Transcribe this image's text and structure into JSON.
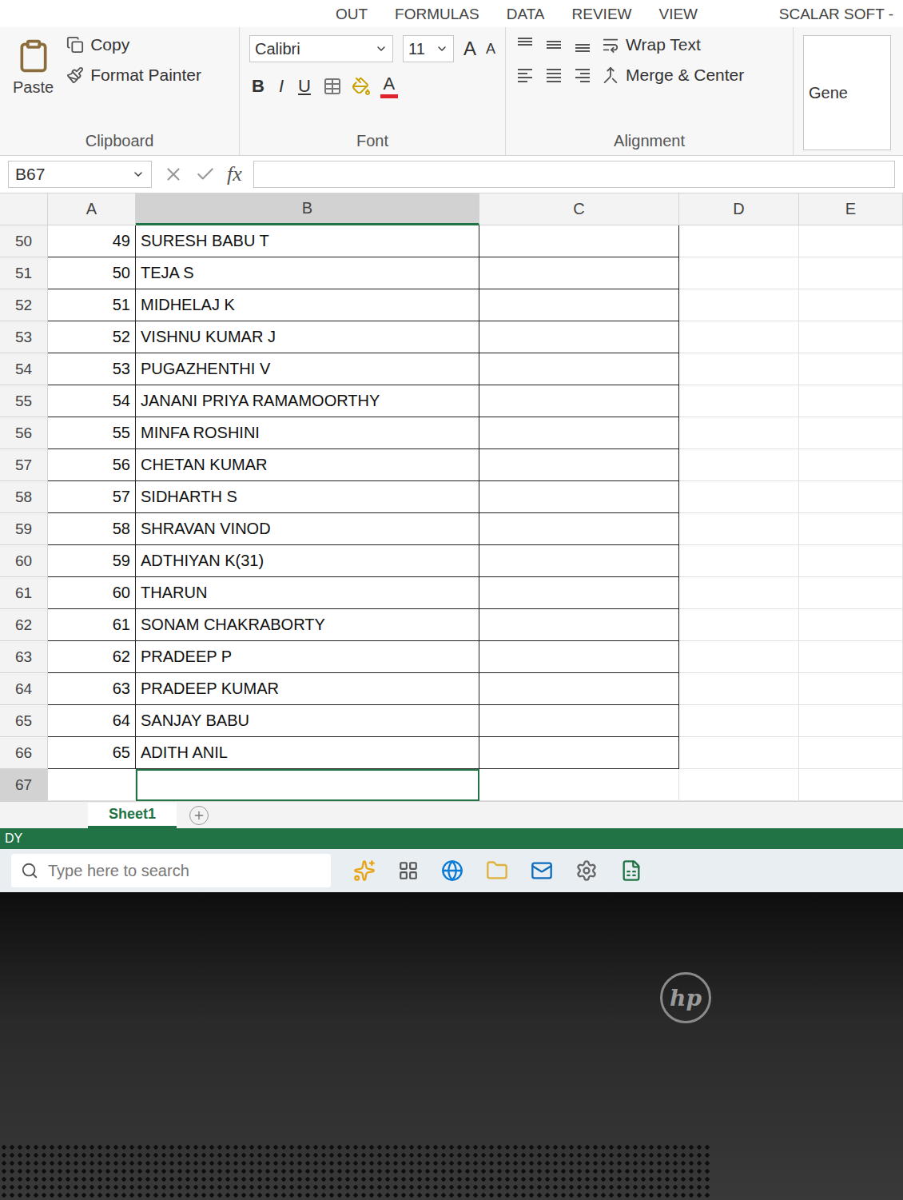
{
  "window": {
    "title": "SCALAR SOFT -"
  },
  "ribbon_tabs": [
    {
      "label": "OUT",
      "selected": false
    },
    {
      "label": "FORMULAS",
      "selected": false
    },
    {
      "label": "DATA",
      "selected": false
    },
    {
      "label": "REVIEW",
      "selected": false
    },
    {
      "label": "VIEW",
      "selected": false
    }
  ],
  "clipboard": {
    "paste": "Paste",
    "copy": "Copy",
    "format_painter": "Format Painter",
    "label": "Clipboard"
  },
  "font": {
    "name": "Calibri",
    "size": "11",
    "grow": "A",
    "shrink": "A",
    "bold": "B",
    "italic": "I",
    "underline": "U",
    "color_letter": "A",
    "label": "Font"
  },
  "alignment": {
    "wrap": "Wrap Text",
    "merge": "Merge & Center",
    "label": "Alignment"
  },
  "number": {
    "format": "Gene"
  },
  "formula_bar": {
    "name_box": "B67",
    "fx": "fx",
    "value": ""
  },
  "columns": [
    {
      "label": "A",
      "selected": false
    },
    {
      "label": "B",
      "selected": true
    },
    {
      "label": "C",
      "selected": false
    },
    {
      "label": "D",
      "selected": false
    },
    {
      "label": "E",
      "selected": false
    }
  ],
  "rows": [
    {
      "number": "50",
      "a": "49",
      "b": "SURESH BABU T",
      "selected": false
    },
    {
      "number": "51",
      "a": "50",
      "b": "TEJA S",
      "selected": false
    },
    {
      "number": "52",
      "a": "51",
      "b": "MIDHELAJ K",
      "selected": false
    },
    {
      "number": "53",
      "a": "52",
      "b": "VISHNU KUMAR J",
      "selected": false
    },
    {
      "number": "54",
      "a": "53",
      "b": "PUGAZHENTHI V",
      "selected": false
    },
    {
      "number": "55",
      "a": "54",
      "b": "JANANI PRIYA RAMAMOORTHY",
      "selected": false
    },
    {
      "number": "56",
      "a": "55",
      "b": "MINFA ROSHINI",
      "selected": false
    },
    {
      "number": "57",
      "a": "56",
      "b": "CHETAN KUMAR",
      "selected": false
    },
    {
      "number": "58",
      "a": "57",
      "b": "SIDHARTH S",
      "selected": false
    },
    {
      "number": "59",
      "a": "58",
      "b": "SHRAVAN VINOD",
      "selected": false
    },
    {
      "number": "60",
      "a": "59",
      "b": "ADTHIYAN K(31)",
      "selected": false
    },
    {
      "number": "61",
      "a": "60",
      "b": "THARUN",
      "selected": false
    },
    {
      "number": "62",
      "a": "61",
      "b": "SONAM CHAKRABORTY",
      "selected": false
    },
    {
      "number": "63",
      "a": "62",
      "b": "PRADEEP P",
      "selected": false
    },
    {
      "number": "64",
      "a": "63",
      "b": "PRADEEP  KUMAR",
      "selected": false
    },
    {
      "number": "65",
      "a": "64",
      "b": "SANJAY BABU",
      "selected": false
    },
    {
      "number": "66",
      "a": "65",
      "b": "ADITH ANIL",
      "selected": false
    },
    {
      "number": "67",
      "a": "",
      "b": "",
      "selected": true
    }
  ],
  "sheets": [
    {
      "label": "Sheet1",
      "selected": true
    }
  ],
  "status": "DY",
  "taskbar": {
    "search_placeholder": "Type here to search"
  },
  "laptop": {
    "logo": "hp"
  }
}
